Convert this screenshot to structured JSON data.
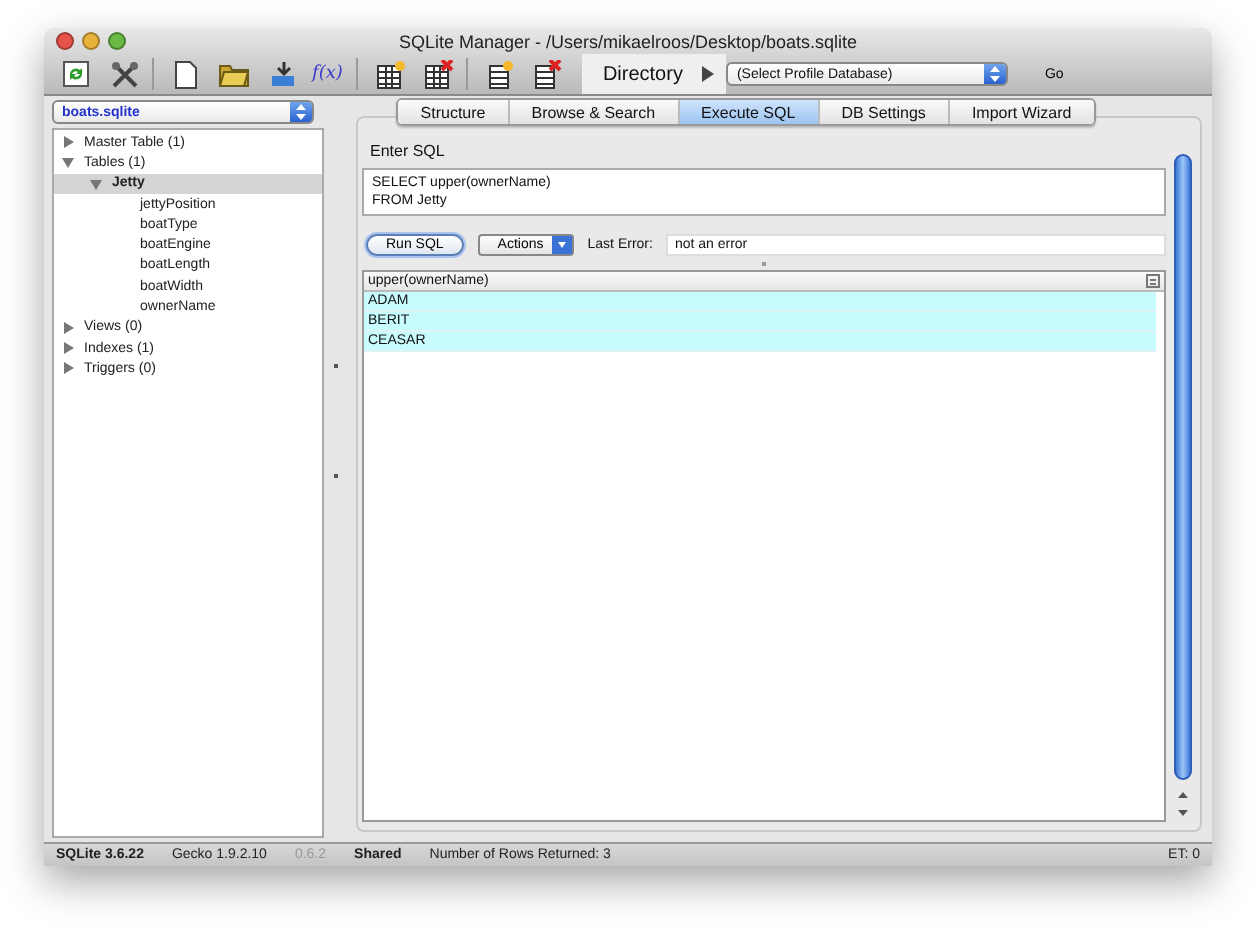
{
  "window": {
    "title": "SQLite Manager - /Users/mikaelroos/Desktop/boats.sqlite"
  },
  "toolbar": {
    "function_label": "f(x)",
    "directory_label": "Directory",
    "profile_select": "(Select Profile Database)",
    "go_button": "Go"
  },
  "sidebar": {
    "database_select": "boats.sqlite",
    "tree": [
      {
        "label": "Master Table (1)",
        "expanded": false,
        "selected": false
      },
      {
        "label": "Tables (1)",
        "expanded": true,
        "selected": false,
        "children": [
          {
            "label": "Jetty",
            "expanded": true,
            "selected": true,
            "children": [
              {
                "label": "jettyPosition",
                "selected": false
              },
              {
                "label": "boatType",
                "selected": false
              },
              {
                "label": "boatEngine",
                "selected": false
              },
              {
                "label": "boatLength",
                "selected": false
              },
              {
                "label": "boatWidth",
                "selected": false
              },
              {
                "label": "ownerName",
                "selected": false
              }
            ]
          }
        ]
      },
      {
        "label": "Views (0)",
        "expanded": false,
        "selected": false
      },
      {
        "label": "Indexes (1)",
        "expanded": false,
        "selected": false
      },
      {
        "label": "Triggers (0)",
        "expanded": false,
        "selected": false
      }
    ]
  },
  "tabs": [
    {
      "label": "Structure",
      "selected": false
    },
    {
      "label": "Browse & Search",
      "selected": false
    },
    {
      "label": "Execute SQL",
      "selected": true
    },
    {
      "label": "DB Settings",
      "selected": false
    },
    {
      "label": "Import Wizard",
      "selected": false
    }
  ],
  "sql": {
    "heading": "Enter SQL",
    "query": "SELECT upper(ownerName)\nFROM Jetty",
    "run_button": "Run SQL",
    "actions_button": "Actions",
    "error_label": "Last Error:",
    "error_value": "not an error"
  },
  "results": {
    "columns": [
      "upper(ownerName)"
    ],
    "rows": [
      {
        "cells": [
          "ADAM"
        ],
        "selected": true
      },
      {
        "cells": [
          "BERIT"
        ],
        "selected": true
      },
      {
        "cells": [
          "CEASAR"
        ],
        "selected": true
      }
    ]
  },
  "status_bar": [
    {
      "text": "SQLite 3.6.22",
      "kind": "bold"
    },
    {
      "text": "Gecko 1.9.2.10",
      "kind": "plain"
    },
    {
      "text": "0.6.2",
      "kind": "dim"
    },
    {
      "text": "Shared",
      "kind": "bold"
    },
    {
      "text": "Number of Rows Returned: 3",
      "kind": "plain"
    },
    {
      "text": "ET: 0",
      "kind": "right"
    }
  ]
}
